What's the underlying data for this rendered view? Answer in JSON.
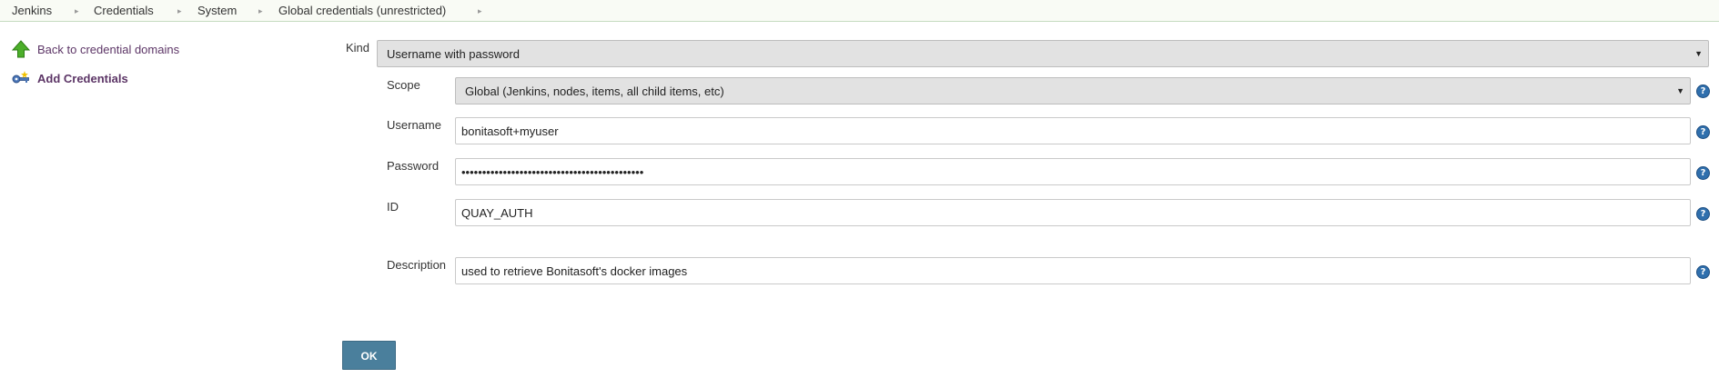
{
  "breadcrumb": {
    "items": [
      "Jenkins",
      "Credentials",
      "System",
      "Global credentials (unrestricted)"
    ],
    "separator_icon": "chevron-right-icon"
  },
  "sidebar": {
    "items": [
      {
        "label": "Back to credential domains",
        "icon": "green-up-arrow-icon"
      },
      {
        "label": "Add Credentials",
        "icon": "key-icon"
      }
    ]
  },
  "form": {
    "kind": {
      "label": "Kind",
      "value": "Username with password"
    },
    "scope": {
      "label": "Scope",
      "value": "Global (Jenkins, nodes, items, all child items, etc)"
    },
    "username": {
      "label": "Username",
      "value": "bonitasoft+myuser"
    },
    "password": {
      "label": "Password",
      "value": "••••••••••••••••••••••••••••••••••••••••••••"
    },
    "id": {
      "label": "ID",
      "value": "QUAY_AUTH"
    },
    "description": {
      "label": "Description",
      "value": "used to retrieve Bonitasoft's docker images"
    },
    "help_glyph": "?",
    "submit_label": "OK"
  },
  "colors": {
    "link": "#5c3566",
    "button": "#4a7f9c",
    "help_icon": "#2f6fad"
  }
}
